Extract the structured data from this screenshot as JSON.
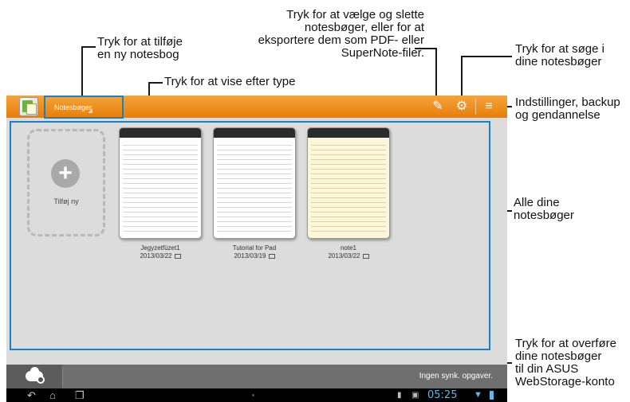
{
  "callouts": {
    "new_notebook": "Tryk for at tilføje\nen ny notesbog",
    "view_by_type": "Tryk for at vise efter type",
    "select_delete": "Tryk for at vælge og slette\nnotesbøger, eller for at\neksportere dem som PDF- eller\nSuperNote-filer.",
    "search": "Tryk for at søge i\ndine notesbøger",
    "settings": "Indstillinger, backup\nog gendannelse",
    "all_notebooks": "Alle dine\nnotesbøger",
    "webstorage": "Tryk for at overføre\ndine notesbøger\ntil din ASUS\nWebStorage-konto"
  },
  "topbar": {
    "dropdown_label": "Notesbøger",
    "icons": [
      "app-icon",
      "select-edit-icon",
      "settings-gear-icon",
      "menu-icon"
    ],
    "accent": "#e8860f"
  },
  "notebooks": {
    "add_label": "Tilføj ny",
    "items": [
      {
        "title": "Jegyzetfüzet1",
        "date": "2013/03/22",
        "paper": "white"
      },
      {
        "title": "Tutorial for Pad",
        "date": "2013/03/19",
        "paper": "white"
      },
      {
        "title": "note1",
        "date": "2013/03/22",
        "paper": "yellow"
      }
    ]
  },
  "bottombar": {
    "sync_status": "Ingen synk. opgaver."
  },
  "statusbar": {
    "time": "05:25",
    "icons": [
      "back-icon",
      "home-icon",
      "recent-apps-icon",
      "notification-icon",
      "image-icon",
      "wifi-icon",
      "battery-icon"
    ]
  },
  "colors": {
    "highlight": "#1b7fc4",
    "toolbar": "#f39a2e",
    "clock": "#5db8e8"
  }
}
